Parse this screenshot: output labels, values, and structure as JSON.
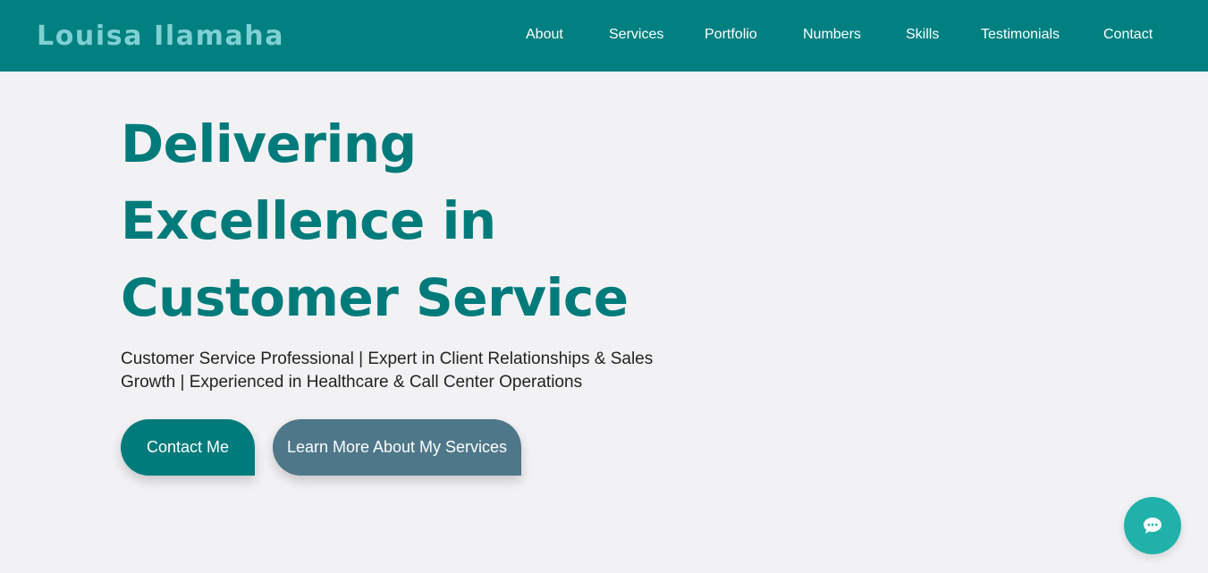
{
  "brand": {
    "name": "Louisa Ilamaha"
  },
  "nav": {
    "items": [
      {
        "label": "About"
      },
      {
        "label": "Services"
      },
      {
        "label": "Portfolio"
      },
      {
        "label": "Numbers"
      },
      {
        "label": "Skills"
      },
      {
        "label": "Testimonials"
      },
      {
        "label": "Contact"
      }
    ]
  },
  "hero": {
    "title_lines": [
      "Delivering",
      "Excellence in",
      "Customer Service"
    ],
    "subtitle_lines": [
      "Customer Service Professional | Expert in Client Relationships & Sales",
      "Growth | Experienced in Healthcare & Call Center Operations"
    ],
    "primary_button": "Contact Me",
    "secondary_button": "Learn More About My Services"
  },
  "chat": {
    "icon": "chat-bubble-icon"
  },
  "colors": {
    "header_bg": "#008080",
    "brand_text": "#7fd0d3",
    "accent": "#007b7b",
    "secondary_button": "#4e7789",
    "chat_button": "#20b2aa",
    "page_bg": "#f2f2f4"
  }
}
